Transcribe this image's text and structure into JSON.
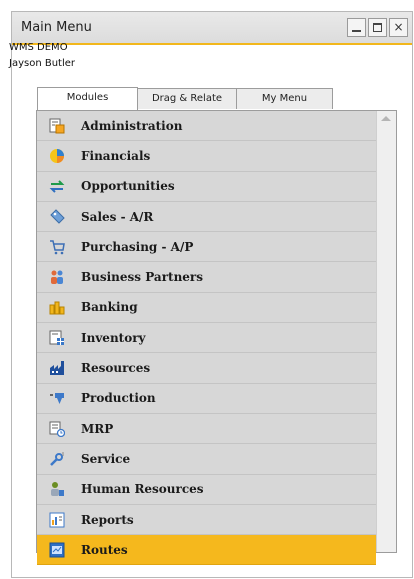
{
  "window": {
    "title": "Main Menu",
    "close_glyph": "×"
  },
  "session": {
    "company": "WMS DEMO",
    "user": "Jayson Butler"
  },
  "tabs": [
    {
      "label": "Modules",
      "active": true
    },
    {
      "label": "Drag & Relate",
      "active": false
    },
    {
      "label": "My Menu",
      "active": false
    }
  ],
  "modules": [
    {
      "label": "Administration",
      "icon": "administration-icon"
    },
    {
      "label": "Financials",
      "icon": "financials-icon"
    },
    {
      "label": "Opportunities",
      "icon": "opportunities-icon"
    },
    {
      "label": "Sales - A/R",
      "icon": "sales-icon"
    },
    {
      "label": "Purchasing - A/P",
      "icon": "purchasing-cart-icon"
    },
    {
      "label": "Business Partners",
      "icon": "business-partners-icon"
    },
    {
      "label": "Banking",
      "icon": "banking-icon"
    },
    {
      "label": "Inventory",
      "icon": "inventory-icon"
    },
    {
      "label": "Resources",
      "icon": "resources-icon"
    },
    {
      "label": "Production",
      "icon": "production-icon"
    },
    {
      "label": "MRP",
      "icon": "mrp-icon"
    },
    {
      "label": "Service",
      "icon": "service-icon"
    },
    {
      "label": "Human Resources",
      "icon": "human-resources-icon"
    },
    {
      "label": "Reports",
      "icon": "reports-icon"
    },
    {
      "label": "Routes",
      "icon": "routes-icon",
      "selected": true
    }
  ],
  "colors": {
    "accent": "#f5b81d",
    "panel": "#d7d7d7"
  }
}
